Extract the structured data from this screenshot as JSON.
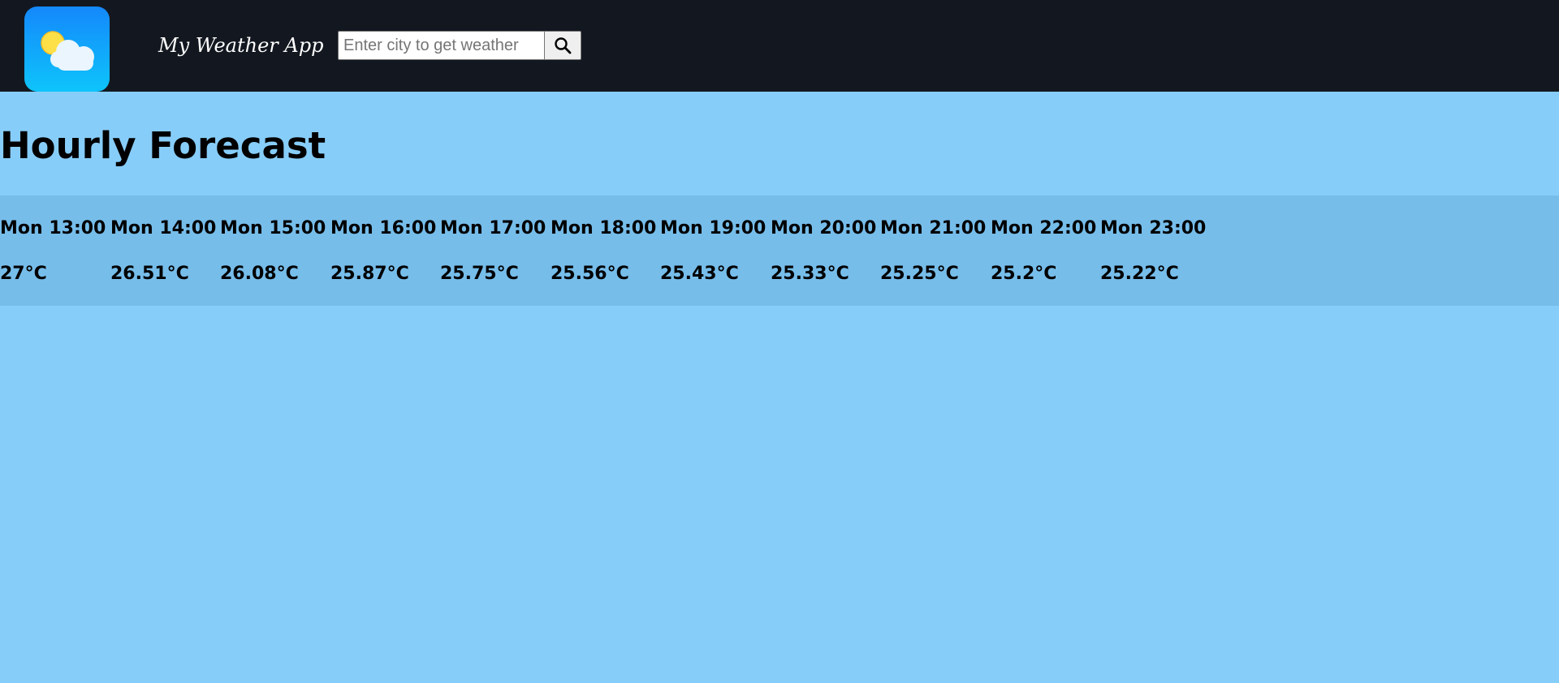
{
  "header": {
    "app_title": "My Weather App",
    "logo_icon": "weather-cloud-sun-icon",
    "search": {
      "value": "",
      "placeholder": "Enter city to get weather",
      "button_icon": "search-icon"
    }
  },
  "main": {
    "title": "Hourly Forecast",
    "forecast": [
      {
        "time": "Mon 13:00",
        "temp": "27°C"
      },
      {
        "time": "Mon 14:00",
        "temp": "26.51°C"
      },
      {
        "time": "Mon 15:00",
        "temp": "26.08°C"
      },
      {
        "time": "Mon 16:00",
        "temp": "25.87°C"
      },
      {
        "time": "Mon 17:00",
        "temp": "25.75°C"
      },
      {
        "time": "Mon 18:00",
        "temp": "25.56°C"
      },
      {
        "time": "Mon 19:00",
        "temp": "25.43°C"
      },
      {
        "time": "Mon 20:00",
        "temp": "25.33°C"
      },
      {
        "time": "Mon 21:00",
        "temp": "25.25°C"
      },
      {
        "time": "Mon 22:00",
        "temp": "25.2°C"
      },
      {
        "time": "Mon 23:00",
        "temp": "25.22°C"
      }
    ]
  },
  "colors": {
    "navbar_bg": "#131820",
    "page_bg": "#87cdf9",
    "forecast_band_bg": "#76bdea",
    "logo_gradient_top": "#1488fb",
    "logo_gradient_bottom": "#0ec4fb",
    "sun": "#fde047"
  }
}
